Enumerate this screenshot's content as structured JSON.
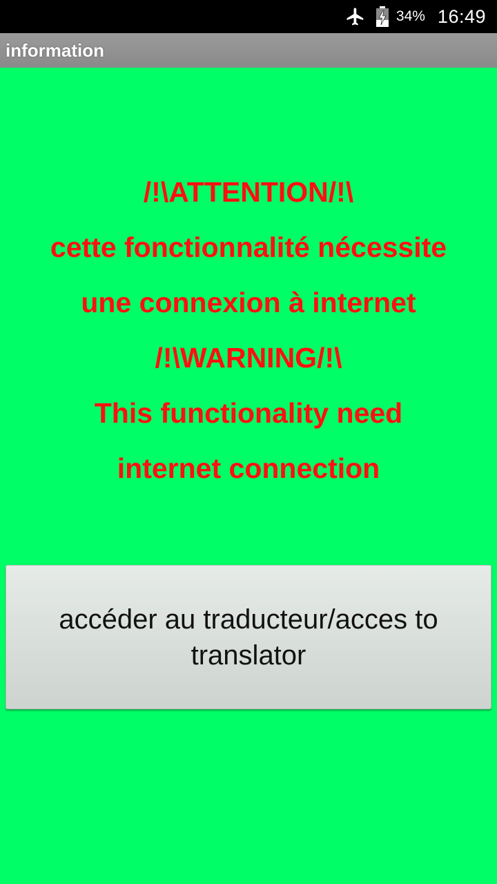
{
  "status_bar": {
    "airplane_icon": "airplane-mode-icon",
    "battery_icon": "battery-charging-icon",
    "battery_percent": "34%",
    "time": "16:49"
  },
  "title_bar": {
    "title": "information"
  },
  "message": {
    "lines": [
      "/!\\ATTENTION/!\\",
      "cette fonctionnalité nécessite",
      "une connexion à internet",
      "/!\\WARNING/!\\",
      "This functionality need",
      "internet connection"
    ]
  },
  "button": {
    "label": "accéder au traducteur/acces to translator"
  },
  "colors": {
    "background": "#00FF66",
    "message_text": "#FF1010",
    "title_bar": "#9A9A9A",
    "status_bar": "#000000"
  }
}
